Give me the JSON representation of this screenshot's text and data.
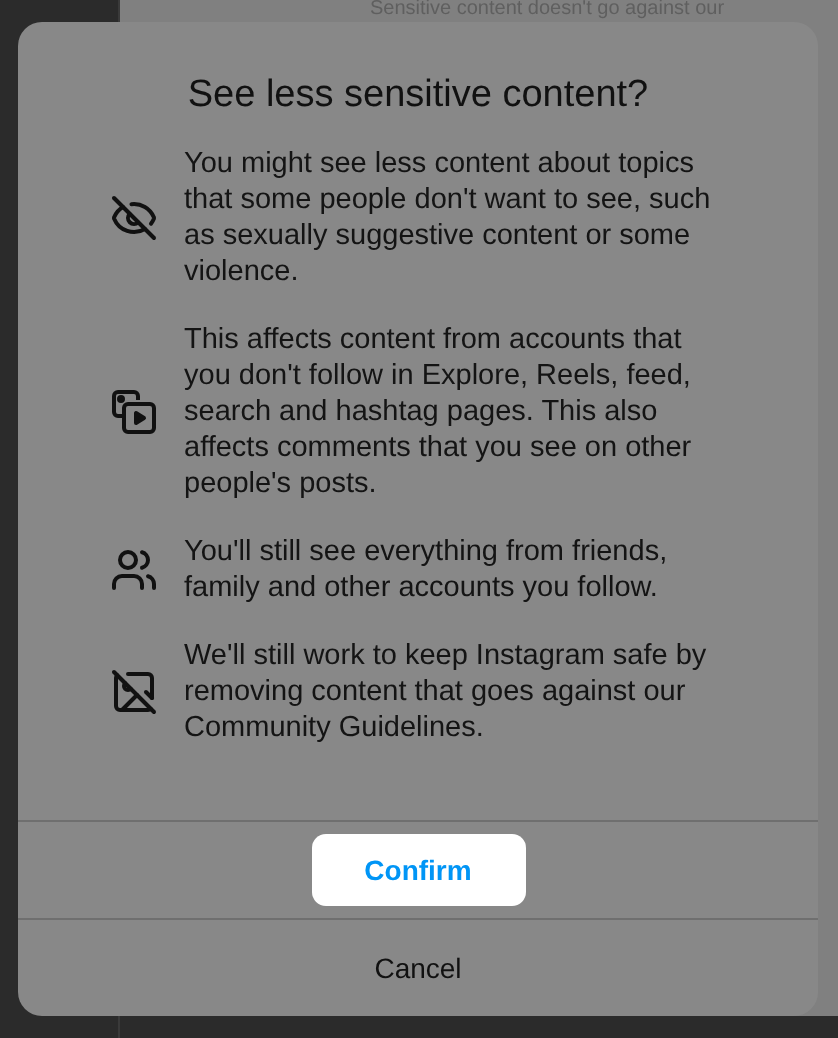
{
  "background": {
    "heading": "Sensitive content doesn't go against our"
  },
  "dialog": {
    "title": "See less sensitive content?",
    "items": [
      {
        "kind": "hidden",
        "text": "You might see less content about topics that some people don't want to see, such as sexually suggestive content or some violence."
      },
      {
        "kind": "media",
        "text": "This affects content from accounts that you don't follow in Explore, Reels, feed, search and hashtag pages. This also affects comments that you see on other people's posts."
      },
      {
        "kind": "people",
        "text": "You'll still see everything from friends, family and other accounts you follow."
      },
      {
        "kind": "blocked",
        "text": "We'll still work to keep Instagram safe by removing content that goes against our Community Guidelines."
      }
    ],
    "buttons": [
      {
        "label": "Confirm",
        "primary": true
      },
      {
        "label": "Cancel",
        "primary": false
      }
    ]
  }
}
